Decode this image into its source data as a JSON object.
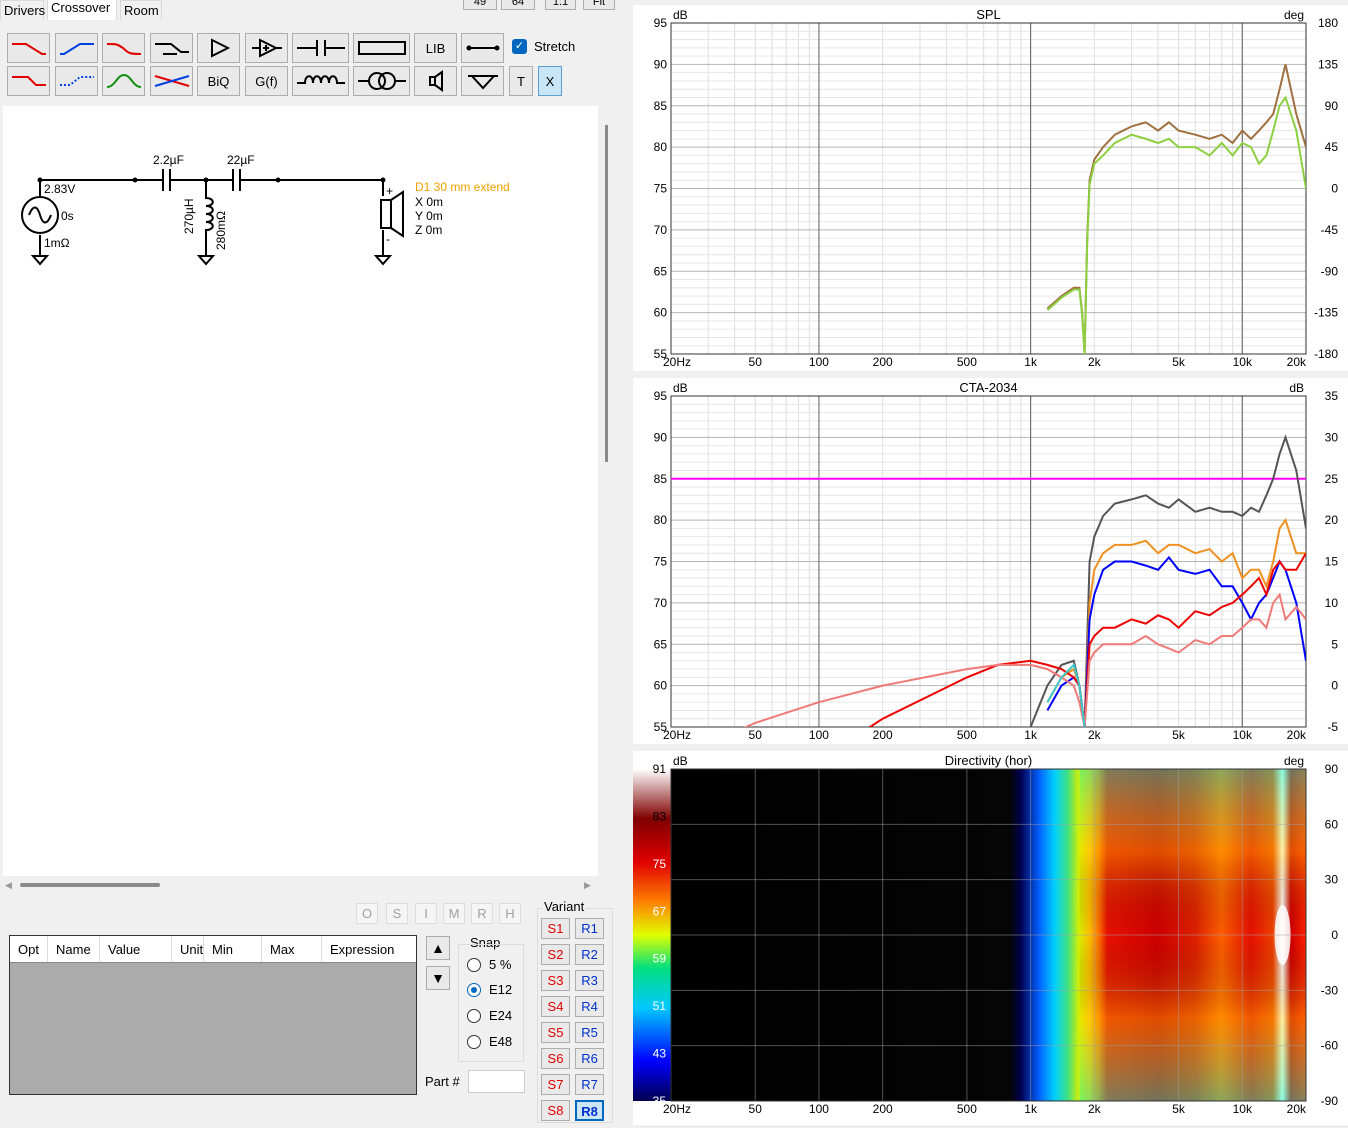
{
  "tabs": {
    "drivers": "Drivers",
    "crossover": "Crossover",
    "room": "Room"
  },
  "topbar": {
    "b1": "49",
    "b2": "64",
    "b3": "1:1",
    "b4": "Fit"
  },
  "toolbar": {
    "biq": "BiQ",
    "gf": "G(f)",
    "lib": "LIB",
    "stretch": "Stretch",
    "t": "T",
    "x": "X"
  },
  "schematic": {
    "source_v": "2.83V",
    "source_delay": "0s",
    "source_r": "1mΩ",
    "c1": "2.2µF",
    "c2": "22µF",
    "l1": "270µH",
    "l1r": "280mΩ",
    "driver_name": "D1 30 mm extend",
    "dx": "X 0m",
    "dy": "Y 0m",
    "dz": "Z 0m",
    "plus": "+",
    "minus": "-"
  },
  "lower": {
    "gray_buttons": [
      "O",
      "S",
      "I",
      "M",
      "R",
      "H"
    ],
    "grid_headers": [
      "Opt",
      "Name",
      "Value",
      "Unit",
      "Min",
      "Max",
      "Expression"
    ],
    "snap_title": "Snap",
    "snap_opts": [
      "5 %",
      "E12",
      "E24",
      "E48"
    ],
    "snap_selected": 1,
    "part_label": "Part #",
    "part_value": "",
    "variant_title": "Variant",
    "s_buttons": [
      "S1",
      "S2",
      "S3",
      "S4",
      "S5",
      "S6",
      "S7",
      "S8"
    ],
    "r_buttons": [
      "R1",
      "R2",
      "R3",
      "R4",
      "R5",
      "R6",
      "R7",
      "R8"
    ],
    "active_variant": "R8"
  },
  "xticks": [
    "20Hz",
    "50",
    "100",
    "200",
    "500",
    "1k",
    "2k",
    "5k",
    "10k",
    "20k"
  ],
  "chart_data": [
    {
      "type": "line",
      "title": "SPL",
      "ylabel": "dB",
      "y2label": "deg",
      "ylim": [
        55,
        95
      ],
      "yticks": [
        "95",
        "90",
        "85",
        "80",
        "75",
        "70",
        "65",
        "60",
        "55"
      ],
      "y2ticks": [
        "180",
        "135",
        "90",
        "45",
        "0",
        "-45",
        "-90",
        "-135",
        "-180"
      ],
      "x": [
        1000,
        1200,
        1400,
        1600,
        1700,
        1750,
        1800,
        1850,
        1900,
        2000,
        2200,
        2500,
        3000,
        3500,
        4000,
        4500,
        5000,
        6000,
        7000,
        8000,
        9000,
        10000,
        11000,
        12000,
        13000,
        14000,
        15000,
        16000,
        18000,
        20000
      ],
      "series": [
        {
          "color": "#a07040",
          "values": [
            null,
            60.5,
            62,
            63,
            63,
            60,
            55,
            69,
            76,
            78.5,
            80,
            81.5,
            82.5,
            83,
            82,
            83,
            82,
            81.5,
            81,
            81.5,
            80.5,
            82,
            81,
            82,
            83,
            84,
            87,
            90,
            84,
            80
          ]
        },
        {
          "color": "#8cd040",
          "values": [
            null,
            60.3,
            61.8,
            62.8,
            62.8,
            59.8,
            55,
            68.5,
            75.5,
            78,
            79,
            80.5,
            81.5,
            81,
            80.5,
            81,
            80,
            80,
            79,
            80.5,
            79,
            80.5,
            80,
            78,
            79,
            82,
            85,
            86,
            82,
            75
          ]
        }
      ]
    },
    {
      "type": "line",
      "title": "CTA-2034",
      "ylabel": "dB",
      "y2label": "dB",
      "ylim": [
        55,
        95
      ],
      "yticks": [
        "95",
        "90",
        "85",
        "80",
        "75",
        "70",
        "65",
        "60",
        "55"
      ],
      "y2ticks": [
        "35",
        "30",
        "25",
        "20",
        "15",
        "10",
        "5",
        "0",
        "-5"
      ],
      "x": [
        20,
        30,
        50,
        100,
        200,
        500,
        700,
        1000,
        1200,
        1400,
        1600,
        1700,
        1800,
        1900,
        2000,
        2200,
        2500,
        3000,
        3500,
        4000,
        4500,
        5000,
        6000,
        7000,
        8000,
        9000,
        10000,
        11000,
        12000,
        13000,
        14000,
        15000,
        16000,
        18000,
        20000
      ],
      "series": [
        {
          "color": "#ff00ff",
          "values": [
            85,
            85,
            85,
            85,
            85,
            85,
            85,
            85,
            85,
            85,
            85,
            85,
            85,
            85,
            85,
            85,
            85,
            85,
            85,
            85,
            85,
            85,
            85,
            85,
            85,
            85,
            85,
            85,
            85,
            85,
            85,
            85,
            85,
            85,
            85
          ]
        },
        {
          "color": "#555555",
          "values": [
            null,
            null,
            null,
            null,
            null,
            null,
            null,
            55,
            60,
            62.5,
            63,
            60,
            55,
            75,
            78,
            80.5,
            82,
            82.5,
            83,
            82,
            81.5,
            82.5,
            81,
            81.5,
            81,
            81,
            80.5,
            81.5,
            81,
            83,
            85,
            88,
            90,
            86,
            79
          ]
        },
        {
          "color": "#f09020",
          "values": [
            null,
            null,
            null,
            null,
            null,
            null,
            null,
            null,
            58,
            61,
            62,
            60,
            55,
            70,
            74,
            76,
            77,
            77,
            77.5,
            76,
            77,
            77,
            76,
            76.5,
            75,
            76,
            73,
            74,
            74,
            72,
            75,
            79,
            80,
            76,
            76
          ]
        },
        {
          "color": "#0000ff",
          "values": [
            null,
            null,
            null,
            null,
            null,
            null,
            null,
            null,
            57,
            60,
            61,
            60,
            55,
            68,
            71,
            74,
            75,
            75,
            74.5,
            74,
            75.5,
            74,
            73.5,
            74,
            72,
            72,
            70,
            68,
            70,
            71,
            73,
            75,
            74,
            70,
            63
          ]
        },
        {
          "color": "#ee0000",
          "values": [
            null,
            null,
            null,
            51,
            56,
            61,
            62.5,
            63,
            62.5,
            62,
            61,
            60,
            55,
            65,
            66,
            67,
            67,
            68,
            67.5,
            68.5,
            68,
            67,
            69,
            68.5,
            69.5,
            70,
            71,
            72,
            73,
            71,
            74,
            75,
            74,
            74,
            76
          ]
        },
        {
          "color": "#f07a78",
          "values": [
            50,
            53,
            55.5,
            58,
            60,
            62,
            62.5,
            62.5,
            62,
            61,
            60,
            58,
            55,
            63,
            64,
            65,
            65,
            65,
            66,
            65,
            64.5,
            64,
            65.5,
            65,
            66,
            66,
            67,
            68,
            68,
            67,
            70,
            71,
            68,
            69.5,
            68
          ]
        },
        {
          "color": "#40c8c8",
          "values": [
            null,
            null,
            null,
            null,
            null,
            null,
            null,
            null,
            58,
            61,
            62.5,
            60,
            55,
            null,
            null,
            null,
            null,
            null,
            null,
            null,
            null,
            null,
            null,
            null,
            null,
            null,
            null,
            null,
            null,
            null,
            null,
            null,
            null,
            null,
            null
          ]
        }
      ]
    },
    {
      "type": "heatmap",
      "title": "Directivity (hor)",
      "ylabel": "dB",
      "y2label": "deg",
      "colorbar_ticks": [
        "91",
        "83",
        "75",
        "67",
        "59",
        "51",
        "43",
        "35"
      ],
      "y2ticks": [
        "90",
        "60",
        "30",
        "0",
        "-30",
        "-60",
        "-90"
      ],
      "zlim": [
        35,
        91
      ]
    }
  ]
}
